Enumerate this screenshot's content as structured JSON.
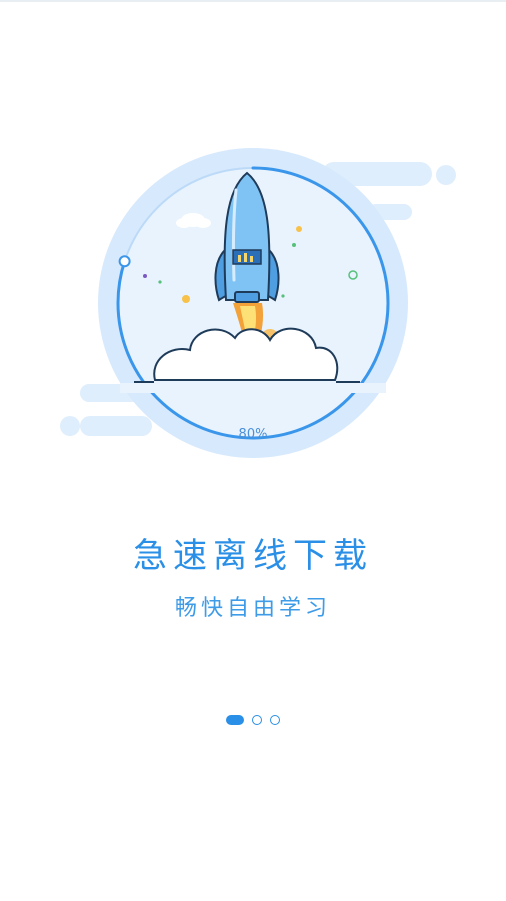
{
  "hero": {
    "progress_label": "80%",
    "progress_fraction": 0.8,
    "colors": {
      "accent": "#2a8fe6",
      "circle_bg": "#d7e9fc",
      "rocket_body": "#7fc3f5",
      "flame_outer": "#f3a23a",
      "flame_inner": "#fde177"
    }
  },
  "title": "急速离线下载",
  "subtitle": "畅快自由学习",
  "pager": {
    "count": 3,
    "active_index": 0
  }
}
